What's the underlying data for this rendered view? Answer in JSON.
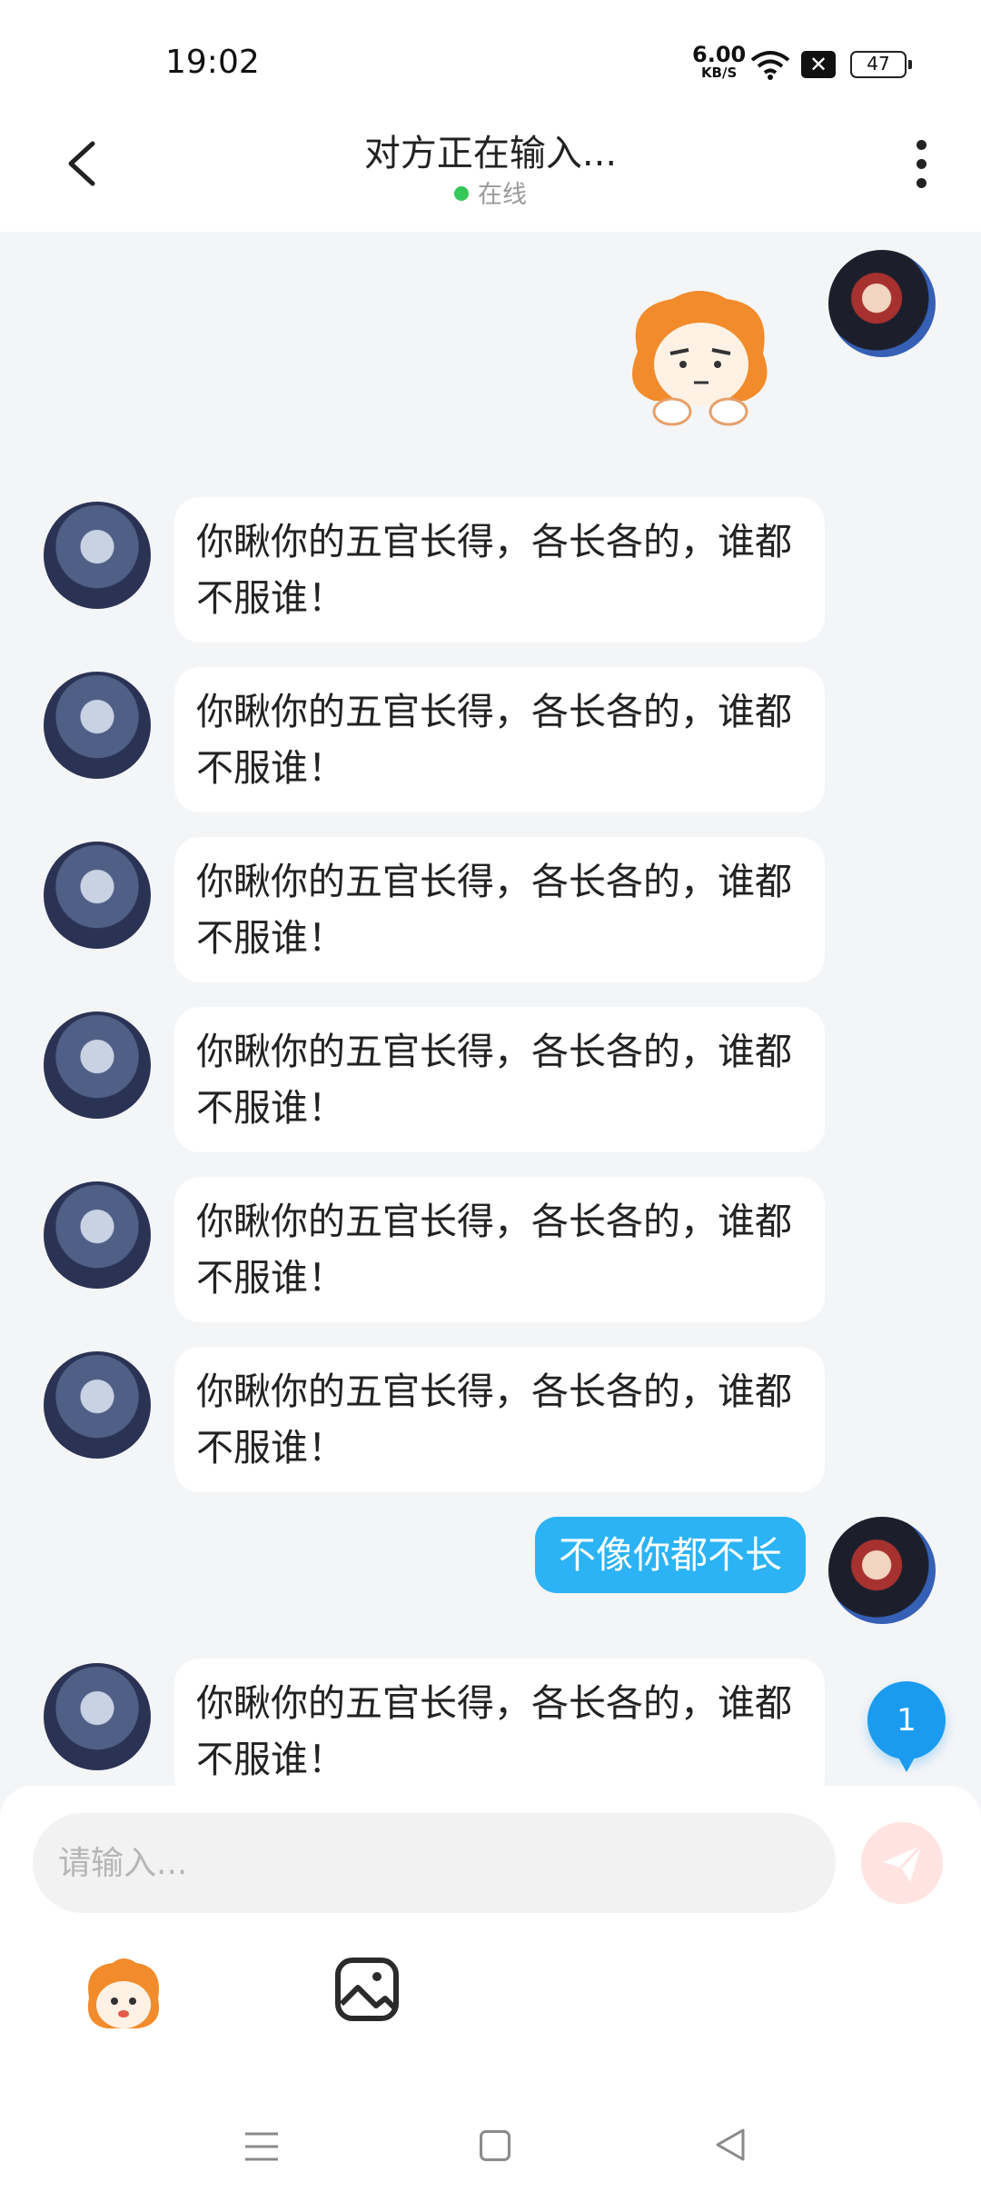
{
  "status_bar": {
    "time": "19:02",
    "net_speed": "6.00",
    "net_unit": "KB/S",
    "battery": "47"
  },
  "header": {
    "title": "对方正在输入...",
    "status": "在线"
  },
  "messages": [
    {
      "side": "left",
      "text": "你瞅你的五官长得，各长各的，谁都不服谁！"
    },
    {
      "side": "left",
      "text": "你瞅你的五官长得，各长各的，谁都不服谁！"
    },
    {
      "side": "left",
      "text": "你瞅你的五官长得，各长各的，谁都不服谁！"
    },
    {
      "side": "left",
      "text": "你瞅你的五官长得，各长各的，谁都不服谁！"
    },
    {
      "side": "left",
      "text": "你瞅你的五官长得，各长各的，谁都不服谁！"
    },
    {
      "side": "left",
      "text": "你瞅你的五官长得，各长各的，谁都不服谁！"
    },
    {
      "side": "right",
      "text": "不像你都不长"
    },
    {
      "side": "left",
      "text": "你瞅你的五官长得，各长各的，谁都不服谁！"
    }
  ],
  "unread_count": "1",
  "input": {
    "placeholder": "请输入...",
    "value": ""
  },
  "colors": {
    "accent": "#2bb3f5",
    "badge": "#1a9bf0",
    "online": "#34c759",
    "send_disabled": "#ffe4e1"
  },
  "icons": [
    "back-icon",
    "more-vert-icon",
    "wifi-icon",
    "send-icon",
    "sticker-icon",
    "image-icon",
    "menu-icon",
    "home-icon",
    "nav-back-icon"
  ]
}
